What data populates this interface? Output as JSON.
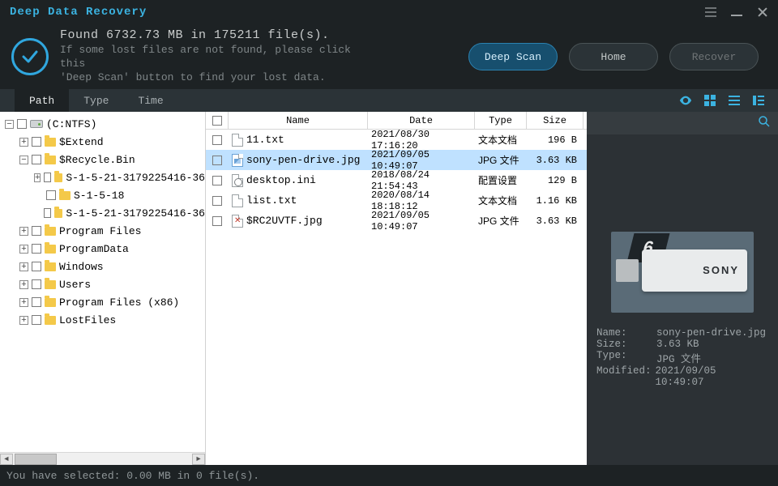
{
  "app_title": "Deep Data Recovery",
  "header": {
    "found_line": "Found 6732.73 MB in 175211 file(s).",
    "hint_line1": "If some lost files are not found, please click this",
    "hint_line2": "'Deep Scan' button to find your lost data.",
    "deep_scan": "Deep Scan",
    "home": "Home",
    "recover": "Recover"
  },
  "tabs": {
    "path": "Path",
    "type": "Type",
    "time": "Time"
  },
  "tree": {
    "root": "(C:NTFS)",
    "items": [
      {
        "level": 1,
        "expand": "+",
        "label": "$Extend"
      },
      {
        "level": 1,
        "expand": "-",
        "label": "$Recycle.Bin"
      },
      {
        "level": 2,
        "expand": "+",
        "label": "S-1-5-21-3179225416-36"
      },
      {
        "level": 2,
        "expand": " ",
        "label": "S-1-5-18"
      },
      {
        "level": 2,
        "expand": " ",
        "label": "S-1-5-21-3179225416-36"
      },
      {
        "level": 1,
        "expand": "+",
        "label": "Program Files"
      },
      {
        "level": 1,
        "expand": "+",
        "label": "ProgramData"
      },
      {
        "level": 1,
        "expand": "+",
        "label": "Windows"
      },
      {
        "level": 1,
        "expand": "+",
        "label": "Users"
      },
      {
        "level": 1,
        "expand": "+",
        "label": "Program Files (x86)"
      },
      {
        "level": 1,
        "expand": "+",
        "label": "LostFiles"
      }
    ]
  },
  "list": {
    "headers": {
      "name": "Name",
      "date": "Date",
      "type": "Type",
      "size": "Size"
    },
    "rows": [
      {
        "icon": "txt",
        "name": "11.txt",
        "date": "2021/08/30 17:16:20",
        "type": "文本文档",
        "size": "196  B",
        "sel": false
      },
      {
        "icon": "jpg",
        "name": "sony-pen-drive.jpg",
        "date": "2021/09/05 10:49:07",
        "type": "JPG 文件",
        "size": "3.63 KB",
        "sel": true
      },
      {
        "icon": "ini",
        "name": "desktop.ini",
        "date": "2018/08/24 21:54:43",
        "type": "配置设置",
        "size": "129  B",
        "sel": false
      },
      {
        "icon": "txt",
        "name": "list.txt",
        "date": "2020/08/14 18:18:12",
        "type": "文本文档",
        "size": "1.16 KB",
        "sel": false
      },
      {
        "icon": "bad",
        "name": "$RC2UVTF.jpg",
        "date": "2021/09/05 10:49:07",
        "type": "JPG 文件",
        "size": "3.63 KB",
        "sel": false
      }
    ]
  },
  "search_placeholder": "",
  "meta": {
    "name_k": "Name:",
    "name_v": "sony-pen-drive.jpg",
    "size_k": "Size:",
    "size_v": "3.63 KB",
    "type_k": "Type:",
    "type_v": "JPG 文件",
    "mod_k": "Modified:",
    "mod_v": "2021/09/05 10:49:07"
  },
  "status": "You have selected: 0.00 MB in 0 file(s).",
  "preview_badge": "6"
}
